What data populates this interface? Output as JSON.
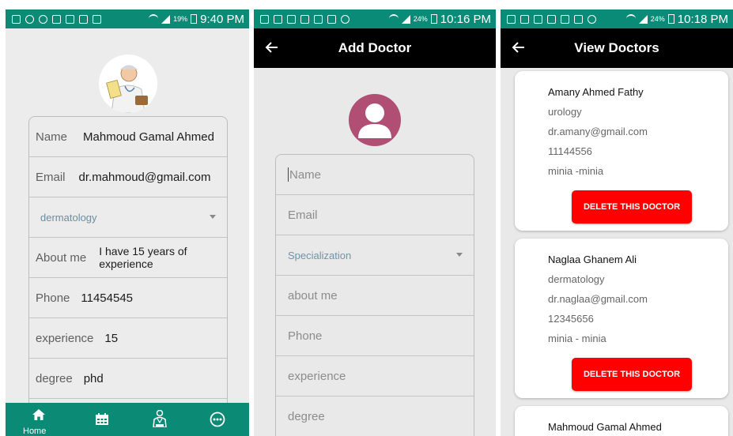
{
  "screens": [
    {
      "status": {
        "battery": "19%",
        "time": "9:40 PM"
      },
      "fields": [
        {
          "label": "Name",
          "value": "Mahmoud Gamal Ahmed"
        },
        {
          "label": "Email",
          "value": "dr.mahmoud@gmail.com"
        },
        {
          "label": "",
          "value": "dermatology"
        },
        {
          "label": "About me",
          "value": "I have 15 years of experience"
        },
        {
          "label": "Phone",
          "value": "11454545"
        },
        {
          "label": "experience",
          "value": "15"
        },
        {
          "label": "degree",
          "value": "phd"
        }
      ],
      "bottom_nav": {
        "home_label": "Home"
      }
    },
    {
      "status": {
        "battery": "24%",
        "time": "10:16 PM"
      },
      "title": "Add Doctor",
      "placeholders": [
        "Name",
        "Email",
        "Specialization",
        "about me",
        "Phone",
        "experience",
        "degree"
      ]
    },
    {
      "status": {
        "battery": "24%",
        "time": "10:18 PM"
      },
      "title": "View Doctors",
      "doctors": [
        {
          "name": "Amany Ahmed Fathy",
          "specialization": "urology",
          "email": "dr.amany@gmail.com",
          "phone": "11144556",
          "address": "minia -minia",
          "button": "DELETE THIS DOCTOR"
        },
        {
          "name": "Naglaa Ghanem Ali",
          "specialization": "dermatology",
          "email": "dr.naglaa@gmail.com",
          "phone": "12345656",
          "address": "minia - minia",
          "button": "DELETE THIS DOCTOR"
        },
        {
          "name": "Mahmoud Gamal Ahmed"
        }
      ]
    }
  ],
  "colors": {
    "status_bar": "#0b8a76",
    "app_bar": "#000000",
    "delete_button": "#ff0000",
    "avatar": "#b04f73"
  }
}
